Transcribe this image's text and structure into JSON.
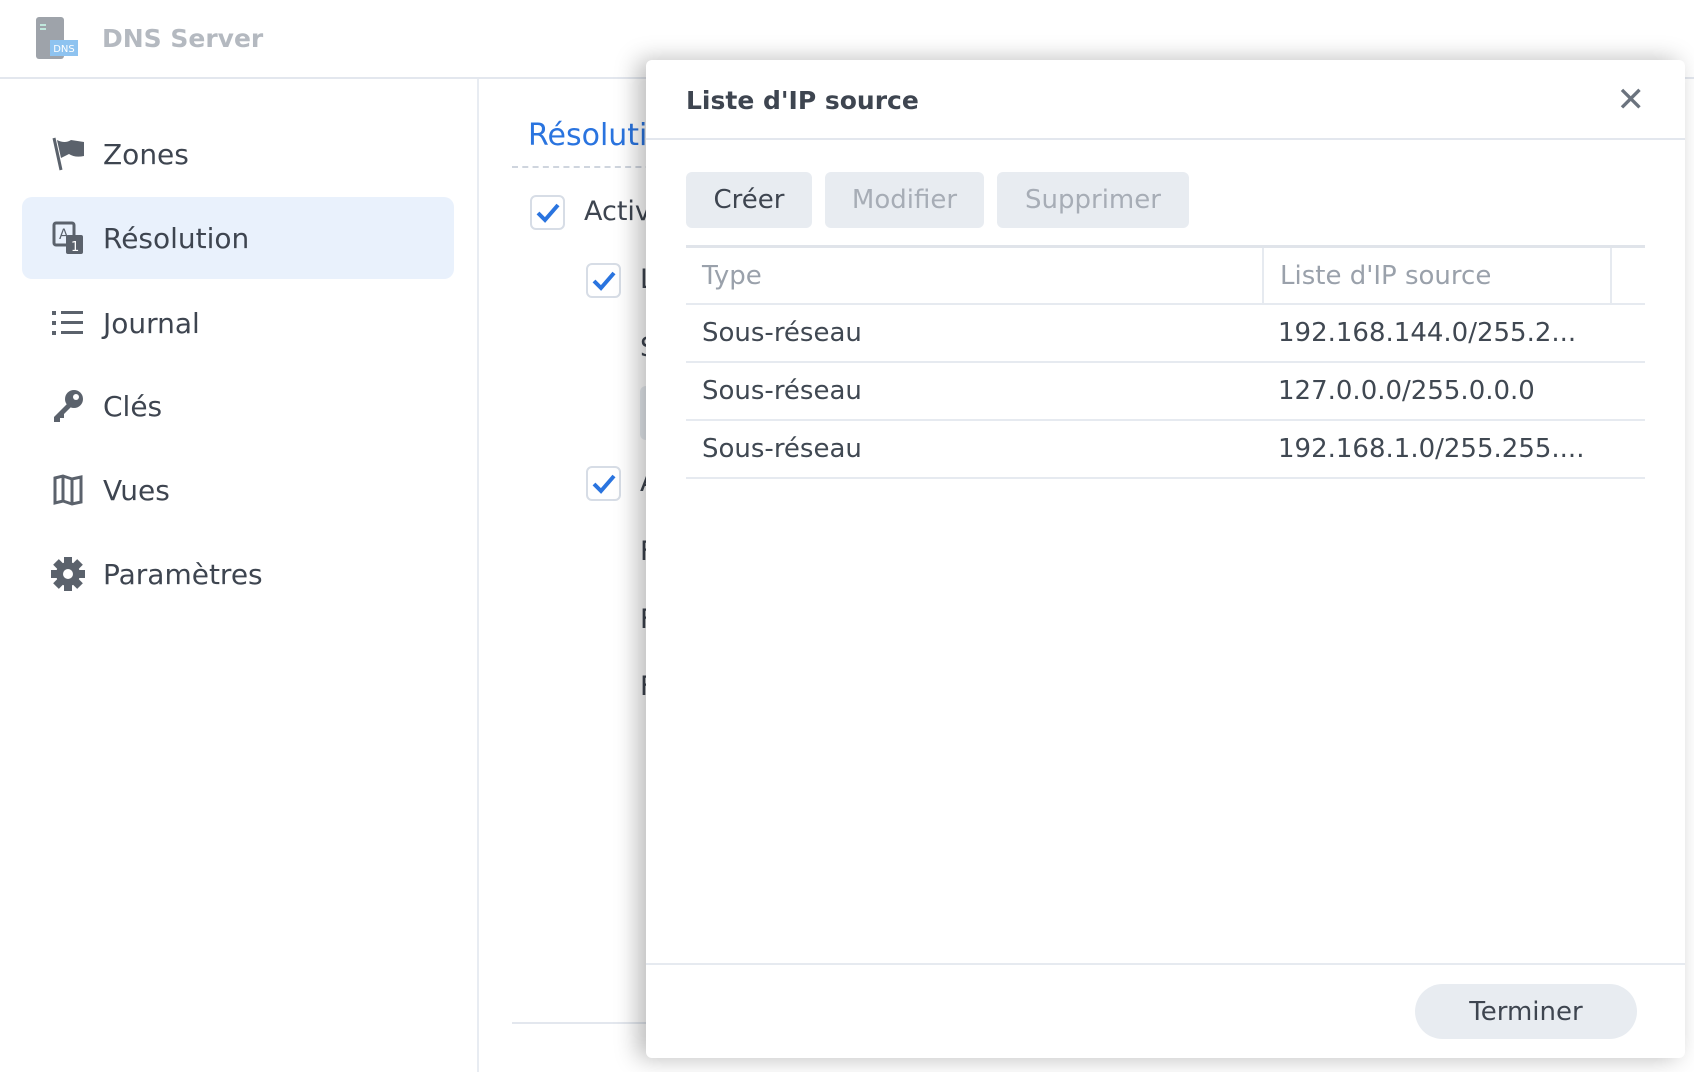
{
  "app": {
    "title": "DNS Server",
    "logo_text": "DNS"
  },
  "sidebar": {
    "items": [
      {
        "label": "Zones",
        "icon": "flag-icon"
      },
      {
        "label": "Résolution",
        "icon": "resolution-icon",
        "selected": true
      },
      {
        "label": "Journal",
        "icon": "list-icon"
      },
      {
        "label": "Clés",
        "icon": "key-icon"
      },
      {
        "label": "Vues",
        "icon": "map-icon"
      },
      {
        "label": "Paramètres",
        "icon": "gear-icon"
      }
    ]
  },
  "main": {
    "title": "Résoluti",
    "fragments": [
      "Activ",
      "L",
      "S",
      "A",
      "F",
      "F",
      "F"
    ],
    "accent": "#2a74df"
  },
  "dialog": {
    "title": "Liste d'IP source",
    "close": "✕",
    "toolbar": {
      "create": "Créer",
      "edit": "Modifier",
      "delete": "Supprimer"
    },
    "columns": [
      "Type",
      "Liste d'IP source"
    ],
    "rows": [
      {
        "type": "Sous-réseau",
        "ip": "192.168.144.0/255.2..."
      },
      {
        "type": "Sous-réseau",
        "ip": "127.0.0.0/255.0.0.0"
      },
      {
        "type": "Sous-réseau",
        "ip": "192.168.1.0/255.255...."
      }
    ],
    "done": "Terminer"
  }
}
